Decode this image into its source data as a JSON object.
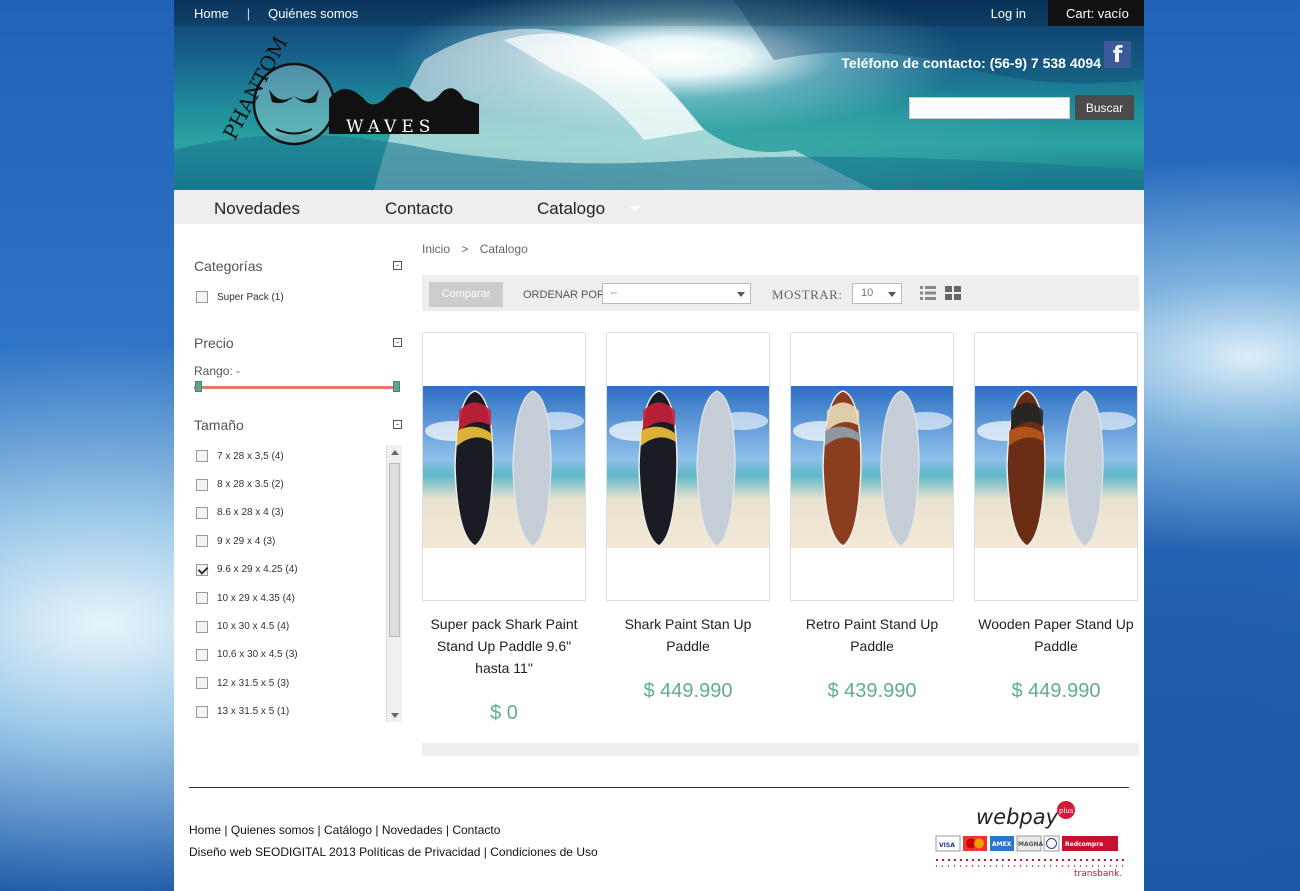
{
  "topnav": {
    "home": "Home",
    "about": "Quiénes somos",
    "login": "Log in",
    "cart": "Cart: vacío"
  },
  "header": {
    "phone": "Teléfono de contacto: (56-9) 7 538 4094",
    "search_placeholder": "",
    "search_button": "Buscar",
    "logo_text_top": "PHANTOM",
    "logo_text_bottom": "WAVES"
  },
  "mainnav": {
    "items": [
      "Novedades",
      "Contacto",
      "Catalogo"
    ]
  },
  "sidebar": {
    "categories": {
      "title": "Categorías",
      "items": [
        {
          "label": "Super Pack (1)",
          "checked": false
        }
      ]
    },
    "price": {
      "title": "Precio",
      "range_label": "Rango: -"
    },
    "size": {
      "title": "Tamaño",
      "items": [
        {
          "label": "7 x 28 x 3,5 (4)",
          "checked": false
        },
        {
          "label": "8 x 28 x 3.5 (2)",
          "checked": false
        },
        {
          "label": "8.6 x 28 x 4 (3)",
          "checked": false
        },
        {
          "label": "9 x 29 x 4 (3)",
          "checked": false
        },
        {
          "label": "9.6 x 29 x 4.25 (4)",
          "checked": true
        },
        {
          "label": "10 x 29 x 4.35 (4)",
          "checked": false
        },
        {
          "label": "10 x 30 x 4.5 (4)",
          "checked": false
        },
        {
          "label": "10.6 x 30 x 4.5 (3)",
          "checked": false
        },
        {
          "label": "12 x 31.5 x 5 (3)",
          "checked": false
        },
        {
          "label": "13 x 31.5 x 5 (1)",
          "checked": false
        }
      ]
    }
  },
  "breadcrumb": {
    "home": "Inicio",
    "sep": ">",
    "current": "Catalogo"
  },
  "toolbar": {
    "compare": "Comparar",
    "sort_label": "ORDENAR POR",
    "sort_value": "--",
    "show_label": "MOSTRAR:",
    "show_value": "10"
  },
  "products": [
    {
      "name": "Super pack Shark Paint Stand Up Paddle 9.6\" hasta 11\"",
      "price": "$ 0",
      "board_colors": [
        "#1b1b24",
        "#c8203a",
        "#f2c23b"
      ]
    },
    {
      "name": "Shark Paint Stan Up Paddle",
      "price": "$ 449.990",
      "board_colors": [
        "#1b1b24",
        "#c8203a",
        "#f2c23b"
      ]
    },
    {
      "name": "Retro Paint Stand Up Paddle",
      "price": "$ 439.990",
      "board_colors": [
        "#8a3e1e",
        "#eadcb8",
        "#8fa0b0"
      ]
    },
    {
      "name": "Wooden Paper Stand Up Paddle",
      "price": "$ 449.990",
      "board_colors": [
        "#6a2e14",
        "#222222",
        "#b8581c"
      ]
    }
  ],
  "footer": {
    "links": [
      "Home",
      "Quienes somos",
      "Catálogo",
      "Novedades",
      "Contacto"
    ],
    "credits": "Diseño web SEODIGITAL 2013 Políticas de Privacidad | Condiciones de Uso"
  },
  "payment": {
    "brand": "webpay",
    "brand_sup": "plus",
    "cards": [
      "VISA",
      "MC",
      "AMEX",
      "MAGNA",
      "DINERS",
      "Redcompra"
    ],
    "provider": "transbank."
  }
}
